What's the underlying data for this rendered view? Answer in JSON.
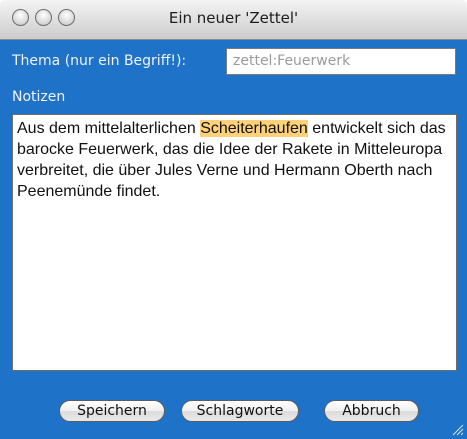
{
  "window": {
    "title": "Ein neuer 'Zettel'"
  },
  "form": {
    "subject_label": "Thema (nur ein Begriff!):",
    "subject_value": "zettel:Feuerwerk",
    "notes_label": "Notizen",
    "notes_before": "Aus dem mittelalterlichen ",
    "notes_highlight": "Scheiterhaufen",
    "notes_after": " entwickelt sich das barocke Feuerwerk, das die Idee der Rakete in Mitteleuropa verbreitet, die über Jules Verne und Hermann Oberth nach Peenemünde findet."
  },
  "buttons": {
    "save": "Speichern",
    "tags": "Schlagworte",
    "cancel": "Abbruch"
  },
  "icons": {
    "close": "close-icon",
    "minimize": "minimize-icon",
    "zoom": "zoom-icon",
    "resize": "resize-grip-icon"
  },
  "colors": {
    "panel": "#1e72c8",
    "highlight": "#ffd27a"
  }
}
